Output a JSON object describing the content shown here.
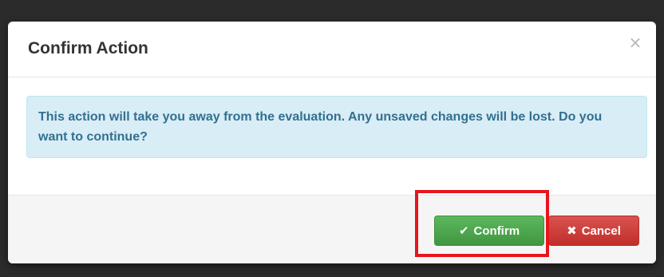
{
  "modal": {
    "title": "Confirm Action",
    "close_symbol": "×",
    "message": "This action will take you away from the evaluation. Any unsaved changes will be lost. Do you want to continue?"
  },
  "buttons": {
    "confirm": {
      "label": "Confirm",
      "icon": "check-icon",
      "icon_glyph": "✔",
      "color": "#5cb85c"
    },
    "cancel": {
      "label": "Cancel",
      "icon": "x-icon",
      "icon_glyph": "✖",
      "color": "#d9534f"
    }
  },
  "colors": {
    "backdrop": "#2b2b2b",
    "alert_bg": "#d9edf7",
    "alert_text": "#31708f",
    "highlight": "#e8141c"
  }
}
